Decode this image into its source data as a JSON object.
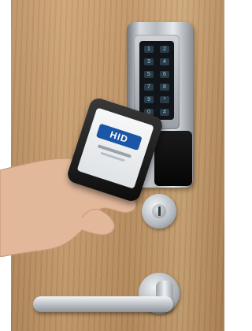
{
  "scene": {
    "door_color": "#c19866",
    "metal_color": "#c8ccd1",
    "keypad_color": "#111418"
  },
  "lock": {
    "keypad_keys": [
      "1",
      "2",
      "3",
      "4",
      "5",
      "6",
      "7",
      "8",
      "9",
      "*",
      "0",
      "#"
    ]
  },
  "phone": {
    "logo_text": "HID"
  }
}
